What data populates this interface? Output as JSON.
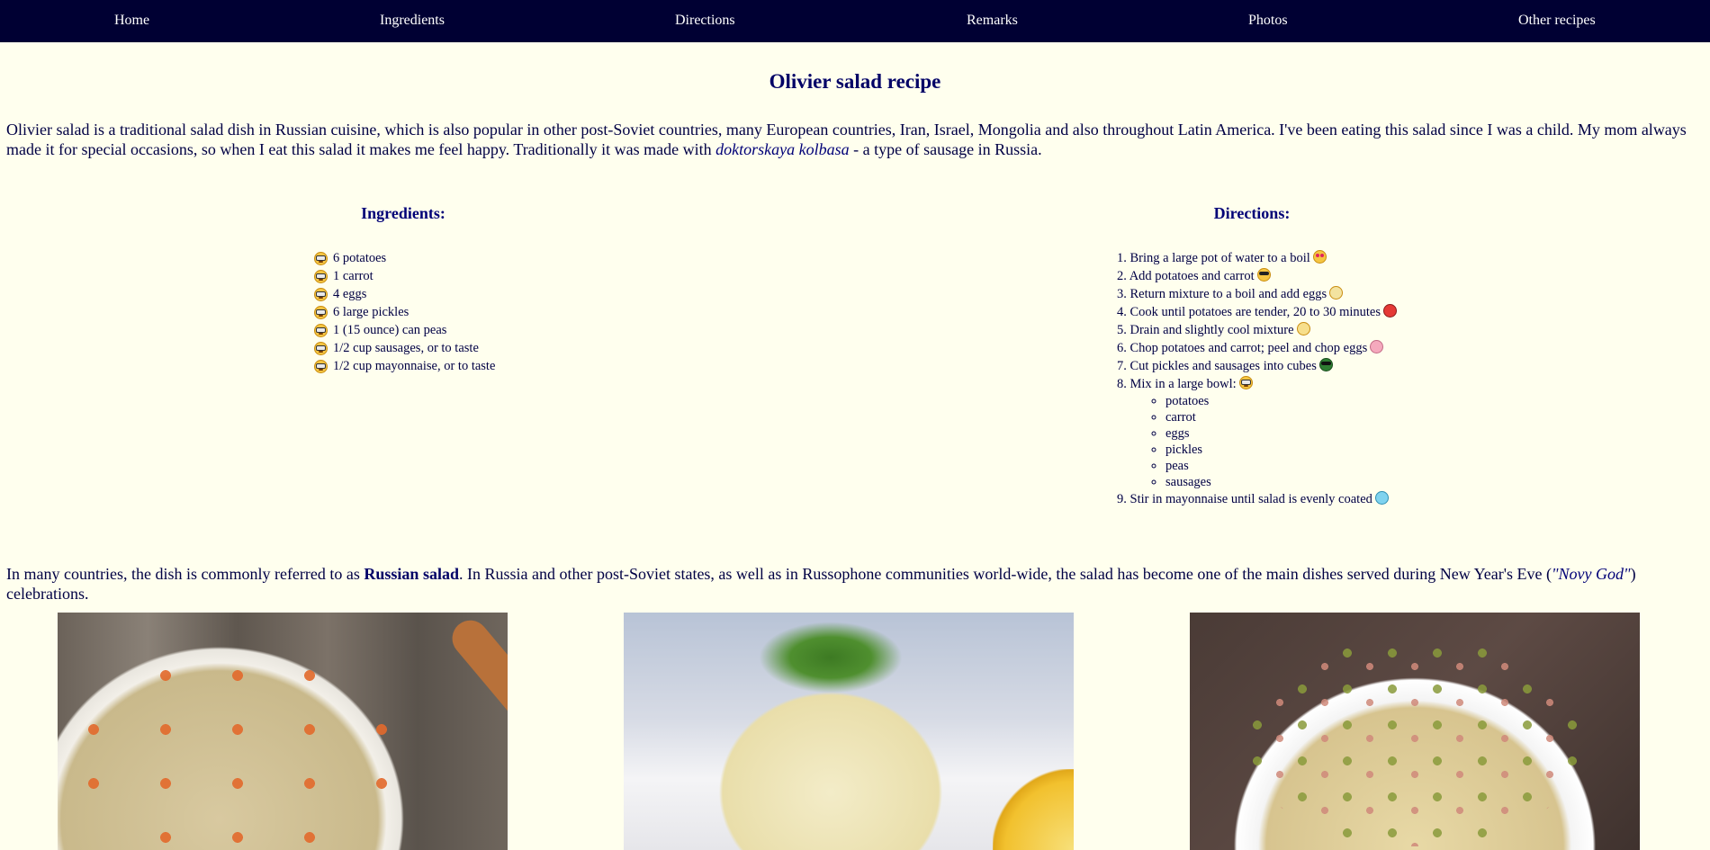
{
  "nav": {
    "items": [
      "Home",
      "Ingredients",
      "Directions",
      "Remarks",
      "Photos",
      "Other recipes"
    ]
  },
  "page": {
    "title": "Olivier salad recipe",
    "intro_before_link": "Olivier salad is a traditional salad dish in Russian cuisine, which is also popular in other post-Soviet countries, many European countries, Iran, Israel, Mongolia and also throughout Latin America. I've been eating this salad since I was a child. My mom always made it for special occasions, so when I eat this salad it makes me feel happy. Traditionally it was made with ",
    "intro_link": "doktorskaya kolbasa",
    "intro_after_link": " - a type of sausage in Russia."
  },
  "ingredients": {
    "heading": "Ingredients:",
    "items": [
      "6 potatoes",
      "1 carrot",
      "4 eggs",
      "6 large pickles",
      "1 (15 ounce) can peas",
      "1/2 cup sausages, or to taste",
      "1/2 cup mayonnaise, or to taste"
    ],
    "bullet_icon": "nerd-face-icon"
  },
  "directions": {
    "heading": "Directions:",
    "steps": [
      {
        "text": "1. Bring a large pot of water to a boil",
        "icon": "heart-eyes-icon"
      },
      {
        "text": "2. Add potatoes and carrot",
        "icon": "sunglasses-face-icon"
      },
      {
        "text": "3. Return mixture to a boil and add eggs",
        "icon": "pale-face-icon"
      },
      {
        "text": "4. Cook until potatoes are tender, 20 to 30 minutes",
        "icon": "angry-devil-icon"
      },
      {
        "text": "5. Drain and slightly cool mixture",
        "icon": "dizzy-face-icon"
      },
      {
        "text": "6. Chop potatoes and carrot; peel and chop eggs",
        "icon": "pig-face-icon"
      },
      {
        "text": "7. Cut pickles and sausages into cubes",
        "icon": "green-cool-face-icon"
      },
      {
        "text": "8. Mix in a large bowl:",
        "icon": "nerd-face-icon"
      },
      {
        "text": "9. Stir in mayonnaise until salad is evenly coated",
        "icon": "cold-face-icon"
      }
    ],
    "bowl_items": [
      "potatoes",
      "carrot",
      "eggs",
      "pickles",
      "peas",
      "sausages"
    ]
  },
  "remarks": {
    "before_bold": "In many countries, the dish is commonly referred to as ",
    "bold": "Russian salad",
    "middle": ". In Russia and other post-Soviet states, as well as in Russophone communities world-wide, the salad has become one of the main dishes served during New Year's Eve (",
    "italic": "\"Novy God\"",
    "after_italic": ") celebrations."
  },
  "colors": {
    "background": "#ffffee",
    "nav_background": "#000033",
    "text": "#000044",
    "heading": "#000077"
  }
}
